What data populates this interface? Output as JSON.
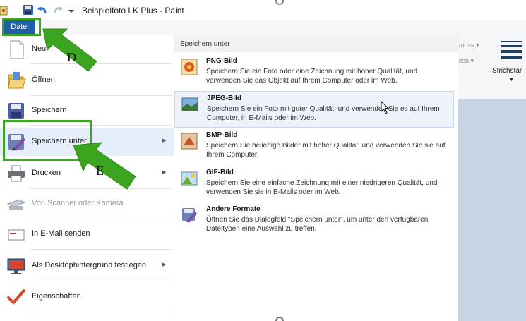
{
  "window": {
    "title": "Beispielfoto LK Plus - Paint"
  },
  "quick_access": {
    "icons": [
      "paint-app-icon",
      "save-icon",
      "undo-icon",
      "redo-icon",
      "customize-dropdown-icon"
    ]
  },
  "tabs": {
    "file": "Datei"
  },
  "ribbon": {
    "frag1": "mriss ▾",
    "frag2": "llen ▾",
    "stroke_label": "Strichstär"
  },
  "file_menu": {
    "items": [
      {
        "label": "Neu",
        "icon": "new-file-icon",
        "submenu": false,
        "disabled": false
      },
      {
        "label": "Öffnen",
        "icon": "open-folder-icon",
        "submenu": false,
        "disabled": false
      },
      {
        "label": "Speichern",
        "icon": "save-icon",
        "submenu": false,
        "disabled": false
      },
      {
        "label": "Speichern unter",
        "icon": "save-as-icon",
        "submenu": true,
        "disabled": false,
        "selected": true
      },
      {
        "label": "Drucken",
        "icon": "printer-icon",
        "submenu": true,
        "disabled": false
      },
      {
        "label": "Von Scanner oder Kamera",
        "icon": "scanner-icon",
        "submenu": false,
        "disabled": true
      },
      {
        "label": "In E-Mail senden",
        "icon": "email-icon",
        "submenu": false,
        "disabled": false
      },
      {
        "label": "Als Desktophintergrund festlegen",
        "icon": "desktop-background-icon",
        "submenu": true,
        "disabled": false
      },
      {
        "label": "Eigenschaften",
        "icon": "checkmark-icon",
        "submenu": false,
        "disabled": false
      }
    ]
  },
  "save_as_submenu": {
    "header": "Speichern unter",
    "items": [
      {
        "title": "PNG-Bild",
        "icon": "png-image-icon",
        "description": "Speichern Sie ein Foto oder eine Zeichnung mit hoher Qualität, und verwenden Sie das Objekt auf Ihrem Computer oder im Web."
      },
      {
        "title": "JPEG-Bild",
        "icon": "jpeg-image-icon",
        "description": "Speichern Sie ein Foto mit guter Qualität, und verwenden Sie es auf Ihrem Computer, in E-Mails oder im Web.",
        "hovered": true
      },
      {
        "title": "BMP-Bild",
        "icon": "bmp-image-icon",
        "description": "Speichern Sie beliebige Bilder mit hoher Qualität, und verwenden Sie sie auf Ihrem Computer."
      },
      {
        "title": "GIF-Bild",
        "icon": "gif-image-icon",
        "description": "Speichern Sie eine einfache Zeichnung mit einer niedrigeren Qualität, und verwenden Sie sie in E-Mails oder im Web."
      },
      {
        "title": "Andere Formate",
        "icon": "other-formats-icon",
        "description": "Öffnen Sie das Dialogfeld \"Speichern unter\", um unter den verfügbaren Dateitypen eine Auswahl zu treffen."
      }
    ]
  },
  "annotations": {
    "label_d": "D",
    "label_e": "E",
    "color": "#3ca520"
  }
}
